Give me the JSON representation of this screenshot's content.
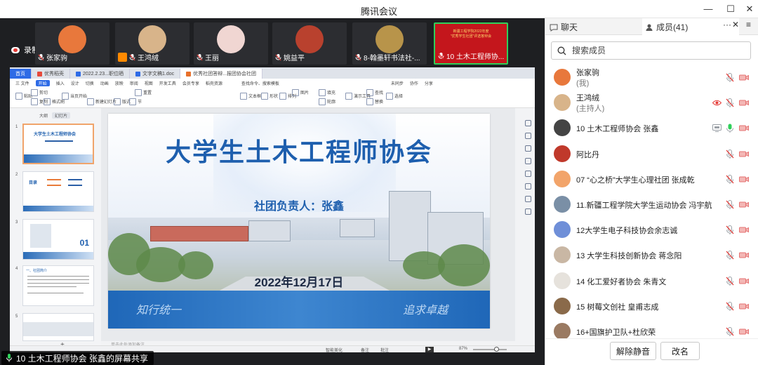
{
  "window": {
    "title": "腾讯会议"
  },
  "meeting": {
    "recording_label": "录制中",
    "participants": [
      {
        "name": "张家驹",
        "avatar": "#e8783c"
      },
      {
        "name": "王鸿绒",
        "avatar": "#d8b48a"
      },
      {
        "name": "王丽",
        "avatar": "#f0d6d2"
      },
      {
        "name": "姚益平",
        "avatar": "#b9412e"
      },
      {
        "name": "8-翰墨轩书法社-...",
        "avatar": "#b8944a"
      },
      {
        "name": "10 土木工程师协...",
        "avatar": "#c4161c"
      }
    ],
    "active_tile_text": "新疆工程学院2022年度\n“优秀学生社团”评选答辩会",
    "share_caption": "10 土木工程师协会 张鑫的屏幕共享"
  },
  "ppt": {
    "tabs": [
      "首页",
      "优秀稻壳",
      "2022.2.23...职位晒",
      "文字文稿1.doc",
      "优秀社团答辩...报团协会社团"
    ],
    "menu": [
      "三 文件",
      "开始",
      "插入",
      "设计",
      "切换",
      "动画",
      "放映",
      "审阅",
      "视图",
      "开发工具",
      "会员专享",
      "稻壳资源",
      "查找命令、搜索模板",
      "未同步",
      "协作",
      "分享"
    ],
    "ribbon": [
      "粘贴",
      "剪切",
      "复制",
      "格式刷",
      "当页开始",
      "新建幻灯片",
      "版式",
      "节",
      "重置",
      "文本框",
      "形状",
      "排列",
      "图片",
      "填充",
      "轮廓",
      "演示工具",
      "查找",
      "替换",
      "选择"
    ],
    "thumb_tabs": [
      "大纲",
      "幻灯片"
    ],
    "thumb_nums": [
      "1",
      "2",
      "3",
      "4",
      "5"
    ],
    "thumb_texts": [
      "大学生土木工程师协会",
      "目录",
      "01",
      "一、社团简介"
    ],
    "notes": "单击此处添加备注",
    "status": [
      "智能美化",
      "备注",
      "批注",
      "87%"
    ],
    "slide": {
      "title": "大学生土木工程师协会",
      "subtitle": "社团负责人：张鑫",
      "date": "2022年12月17日",
      "motto_left": "知行统一",
      "motto_right": "追求卓越"
    }
  },
  "panel": {
    "tab_chat": "聊天",
    "tab_members": "成员(41)",
    "search_placeholder": "搜索成员",
    "members": [
      {
        "name": "张家驹",
        "role": "(我)",
        "avatar": "#e8783c",
        "mic": "muted",
        "cam": "off"
      },
      {
        "name": "王鸿绒",
        "role": "(主持人)",
        "avatar": "#d8b48a",
        "mic": "muted",
        "cam": "off",
        "extra": "eye"
      },
      {
        "name": "10 土木工程师协会 张鑫",
        "role": "",
        "avatar": "#444444",
        "mic": "on",
        "cam": "off",
        "extra": "screen"
      },
      {
        "name": "阿比丹",
        "role": "",
        "avatar": "#c0392b",
        "mic": "muted",
        "cam": "off"
      },
      {
        "name": "07 “心之桥”大学生心理社团 张成乾",
        "role": "",
        "avatar": "#f2a46a",
        "mic": "muted",
        "cam": "off"
      },
      {
        "name": "11.新疆工程学院大学生运动协会 冯宇航",
        "role": "",
        "avatar": "#7a8fa6",
        "mic": "muted",
        "cam": "off"
      },
      {
        "name": "12大学生电子科技协会余志诚",
        "role": "",
        "avatar": "#6f8fd8",
        "mic": "muted",
        "cam": "off"
      },
      {
        "name": "13 大学生科技创新协会 蒋念阳",
        "role": "",
        "avatar": "#c9b7a4",
        "mic": "muted",
        "cam": "off"
      },
      {
        "name": "14 化工爱好者协会 朱青文",
        "role": "",
        "avatar": "#e6e2dc",
        "mic": "muted",
        "cam": "off"
      },
      {
        "name": "15 树莓文创社 皇甫志成",
        "role": "",
        "avatar": "#8a6a4a",
        "mic": "muted",
        "cam": "off"
      },
      {
        "name": "16+国旗护卫队+杜欣荣",
        "role": "",
        "avatar": "#9a7a62",
        "mic": "muted",
        "cam": "off"
      }
    ],
    "unmute_label": "解除静音",
    "rename_label": "改名"
  },
  "colors": {
    "accent": "#1e5fae",
    "muted_red": "#e53935",
    "mic_green": "#2fcf5a"
  }
}
